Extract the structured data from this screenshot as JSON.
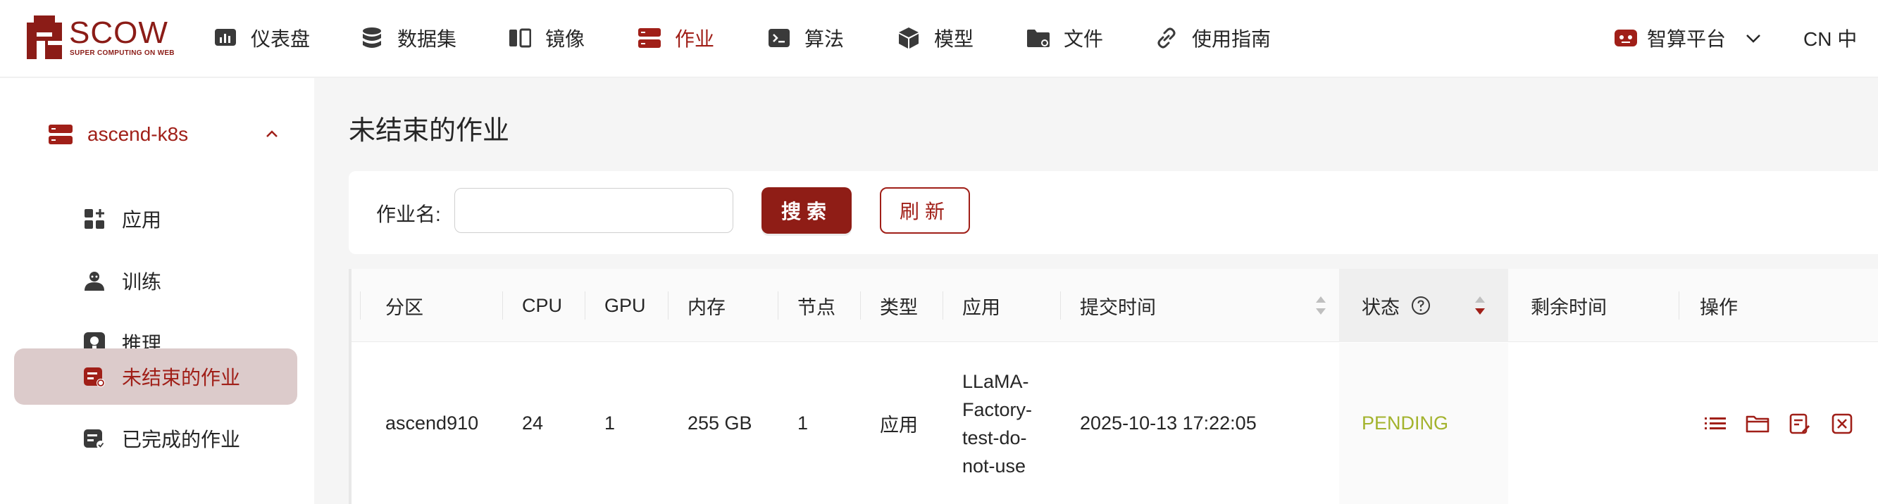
{
  "brand": {
    "name": "SCOW",
    "tagline": "SUPER COMPUTING ON WEB",
    "color": "#8b1c17"
  },
  "nav": [
    {
      "label": "仪表盘",
      "icon": "dashboard-icon"
    },
    {
      "label": "数据集",
      "icon": "database-icon"
    },
    {
      "label": "镜像",
      "icon": "image-icon"
    },
    {
      "label": "作业",
      "icon": "job-server-icon",
      "active": true
    },
    {
      "label": "算法",
      "icon": "terminal-icon"
    },
    {
      "label": "模型",
      "icon": "cube-icon"
    },
    {
      "label": "文件",
      "icon": "folder-icon"
    },
    {
      "label": "使用指南",
      "icon": "link-icon"
    }
  ],
  "platform": {
    "label": "智算平台"
  },
  "language": {
    "label": "CN 中"
  },
  "sidebar": {
    "group": {
      "label": "ascend-k8s"
    },
    "items": [
      {
        "label": "应用",
        "icon": "apps-icon"
      },
      {
        "label": "训练",
        "icon": "training-icon"
      },
      {
        "label": "推理",
        "icon": "inference-icon"
      },
      {
        "label": "未结束的作业",
        "icon": "running-jobs-icon",
        "active": true
      },
      {
        "label": "已完成的作业",
        "icon": "finished-jobs-icon"
      }
    ]
  },
  "page": {
    "title": "未结束的作业"
  },
  "filter": {
    "job_name_label": "作业名:",
    "job_name_value": "",
    "job_name_placeholder": "",
    "search_label": "搜索",
    "refresh_label": "刷新"
  },
  "table": {
    "columns": [
      "分区",
      "CPU",
      "GPU",
      "内存",
      "节点",
      "类型",
      "应用",
      "提交时间",
      "状态",
      "剩余时间",
      "操作"
    ],
    "rows": [
      {
        "partition": "ascend910",
        "cpu": "24",
        "gpu": "1",
        "memory": "255 GB",
        "nodes": "1",
        "type": "应用",
        "app_lines": [
          "LLaMA-",
          "Factory-",
          "test-do-",
          "not-use"
        ],
        "submit_time": "2025-10-13 17:22:05",
        "status": "PENDING",
        "remaining": "",
        "actions": [
          "list-icon",
          "folder-icon",
          "edit-note-icon",
          "close-box-icon"
        ]
      }
    ]
  },
  "colors": {
    "accent": "#a01f18",
    "status_pending": "#a3b32d",
    "active_bg": "#dccbcb"
  }
}
